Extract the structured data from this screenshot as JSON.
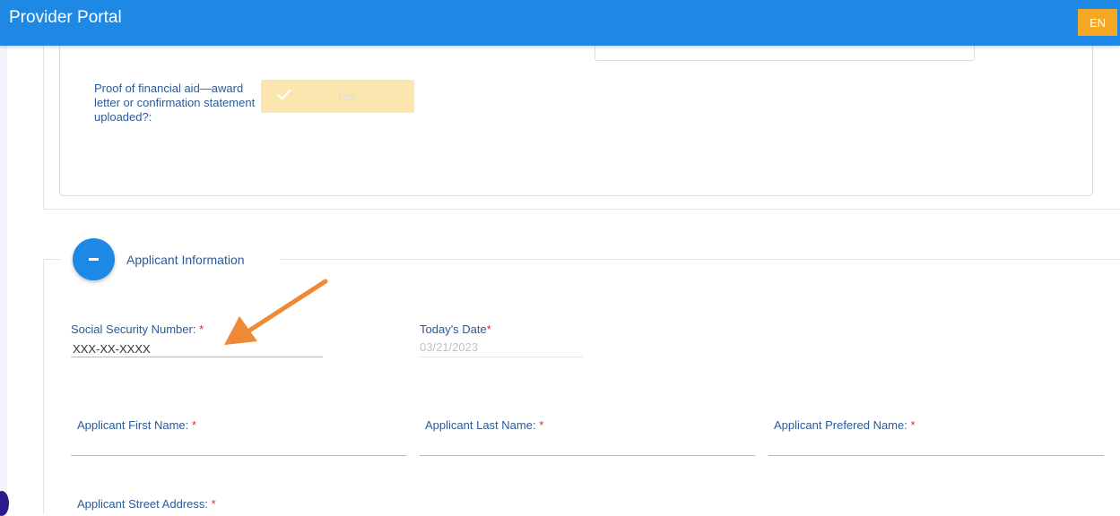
{
  "header": {
    "title": "Provider Portal",
    "language_button": "EN",
    "colors": {
      "bar": "#1e88e5",
      "language": "#f5a623"
    }
  },
  "financial_aid": {
    "label": "Proof of financial aid—award letter or confirmation statement uploaded?:",
    "toggle_value": "Yes",
    "toggle_icon": "check-icon"
  },
  "applicant_section": {
    "title": "Applicant Information",
    "toggle_icon": "minus-icon",
    "ssn": {
      "label": "Social Security Number:",
      "required": "*",
      "value": "XXX-XX-XXXX"
    },
    "today_date": {
      "label": "Today's Date",
      "required": "*",
      "value": "03/21/2023"
    },
    "first_name": {
      "label": "Applicant First Name:",
      "required": "*",
      "value": ""
    },
    "last_name": {
      "label": "Applicant Last Name:",
      "required": "*",
      "value": ""
    },
    "preferred_name": {
      "label": "Applicant Prefered Name:",
      "required": "*",
      "value": ""
    },
    "street_address": {
      "label": "Applicant Street Address:",
      "required": "*",
      "value": ""
    }
  },
  "annotation": {
    "icon": "arrow-icon",
    "color": "#ee8a35"
  }
}
